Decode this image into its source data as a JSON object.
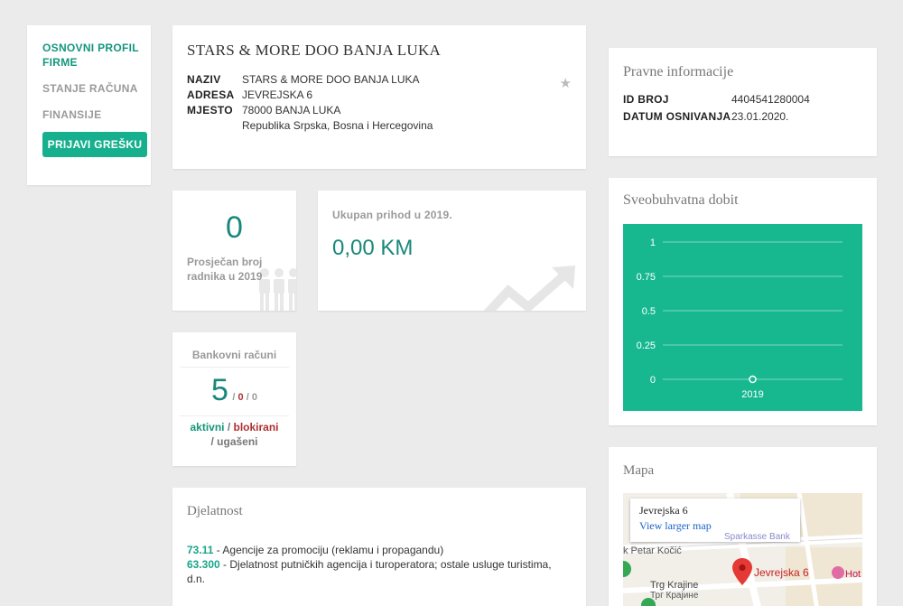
{
  "sidebar": {
    "items": [
      {
        "label": "OSNOVNI PROFIL FIRME"
      },
      {
        "label": "STANJE RAČUNA"
      },
      {
        "label": "FINANSIJE"
      }
    ],
    "report_button": "PRIJAVI GREŠKU"
  },
  "company": {
    "title": "STARS & MORE DOO BANJA LUKA",
    "fields": {
      "naziv_label": "NAZIV",
      "naziv_value": "STARS & MORE DOO BANJA LUKA",
      "adresa_label": "ADRESA",
      "adresa_value": "JEVREJSKA 6",
      "mjesto_label": "MJESTO",
      "mjesto_value": "78000 BANJA LUKA",
      "region_value": "Republika Srpska, Bosna i Hercegovina"
    },
    "star_icon": "star-icon"
  },
  "workers": {
    "value": "0",
    "label": "Prosječan broj radnika u 2019"
  },
  "revenue": {
    "label": "Ukupan prihod u 2019.",
    "amount": "0,00 KM"
  },
  "bank": {
    "header": "Bankovni računi",
    "active": "5",
    "sep1": " / ",
    "blocked": "0",
    "sep2": " / ",
    "closed": "0",
    "legend_active": "aktivni",
    "legend_sep": " / ",
    "legend_blocked": "blokirani",
    "legend_closed": "/ ugašeni"
  },
  "activity": {
    "header": "Djelatnost",
    "items": [
      {
        "code": "73.11",
        "sep": " - ",
        "text": "Agencije za promociju (reklamu i propagandu)"
      },
      {
        "code": "63.300",
        "sep": " - ",
        "text": "Djelatnost putničkih agencija i turoperatora; ostale usluge turistima, d.n."
      }
    ]
  },
  "legal": {
    "header": "Pravne informacije",
    "id_label": "ID BROJ",
    "id_value": "4404541280004",
    "date_label": "DATUM OSNIVANJA",
    "date_value": "23.01.2020."
  },
  "profit": {
    "header": "Sveobuhvatna dobit"
  },
  "chart_data": {
    "type": "line",
    "title": "Sveobuhvatna dobit",
    "categories": [
      "2019"
    ],
    "series": [
      {
        "values": [
          0
        ]
      }
    ],
    "yticks": [
      "1",
      "0.75",
      "0.5",
      "0.25",
      "0"
    ],
    "ylim": [
      0,
      1
    ],
    "grid": true,
    "background_color": "#17b890"
  },
  "map": {
    "header": "Mapa",
    "popup_address": "Jevrejska 6",
    "popup_link": "View larger map",
    "marker_label": "Jevrejska 6",
    "street_label": "k Petar Kočić",
    "square_label": "Trg Krajine",
    "square_label_cyr": "Трг Крајине",
    "poi_label": "Hot",
    "bank_label": "Sparkasse Bank"
  },
  "colors": {
    "accent": "#17b08e",
    "accent_dark": "#17887a",
    "blocked_red": "#b03030"
  }
}
